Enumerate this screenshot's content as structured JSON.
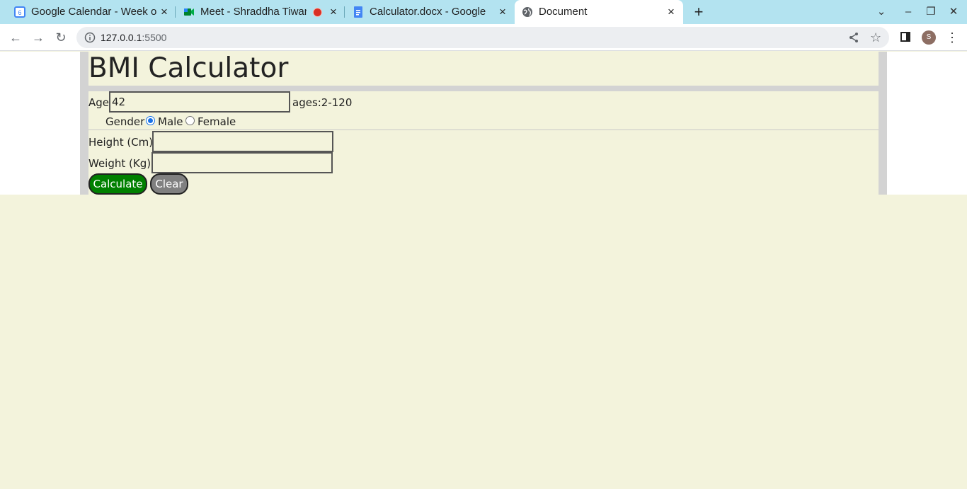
{
  "browser": {
    "tabs": [
      {
        "title": "Google Calendar - Week o",
        "favicon": "calendar-icon",
        "active": false
      },
      {
        "title": "Meet - Shraddha Tiwar",
        "favicon": "meet-icon",
        "recording": true,
        "active": false
      },
      {
        "title": "Calculator.docx - Google D",
        "favicon": "docs-icon",
        "active": false
      },
      {
        "title": "Document",
        "favicon": "globe-icon",
        "active": true
      }
    ],
    "url_host": "127.0.0.1",
    "url_port": ":5500",
    "profile_initial": "S"
  },
  "page": {
    "title": "BMI Calculator",
    "age": {
      "label": "Age",
      "value": "42",
      "hint": "ages:2-120"
    },
    "gender": {
      "label": "Gender",
      "options": [
        "Male",
        "Female"
      ],
      "selected": "Male"
    },
    "height": {
      "label": "Height (Cm)",
      "value": ""
    },
    "weight": {
      "label": "Weight (Kg)",
      "value": ""
    },
    "buttons": {
      "calculate": "Calculate",
      "clear": "Clear"
    }
  },
  "colors": {
    "page_background": "#f3f3dc",
    "calculate_button": "#008000",
    "clear_button": "#808080",
    "tab_strip": "#b3e3f0"
  }
}
